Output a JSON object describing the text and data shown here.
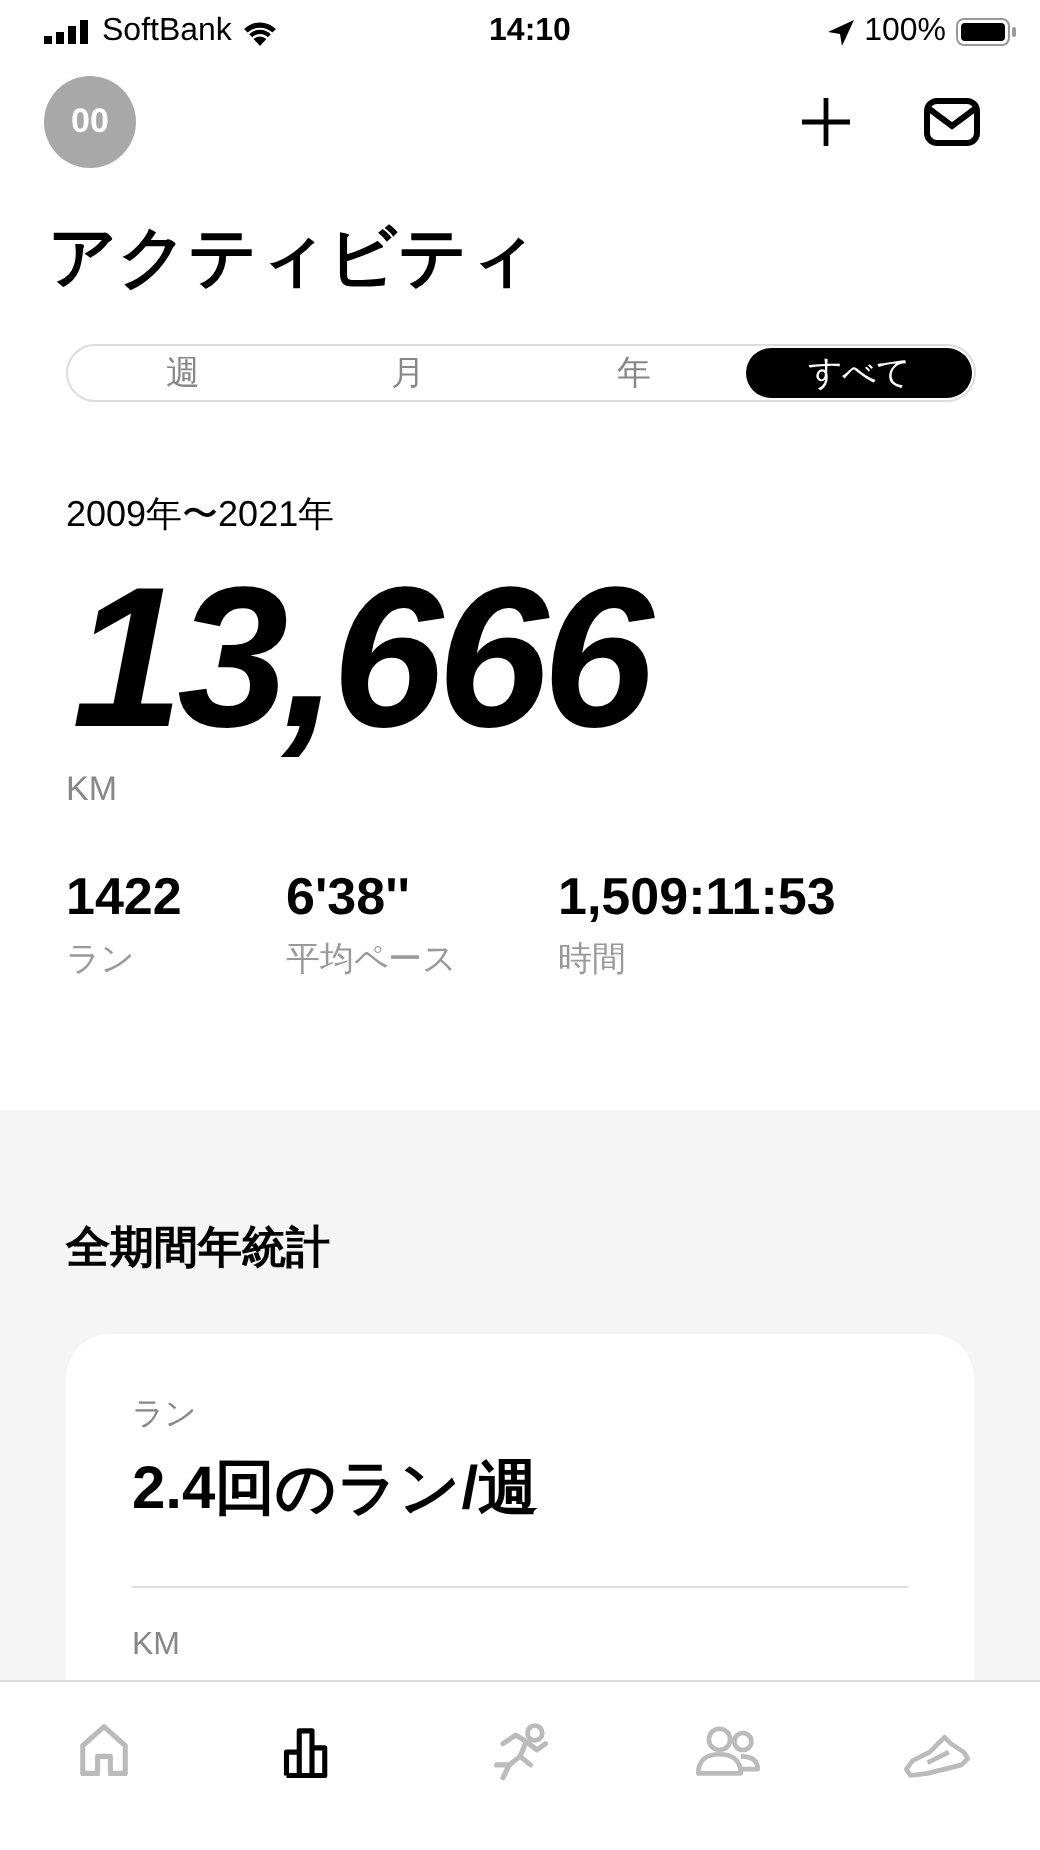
{
  "status_bar": {
    "carrier": "SoftBank",
    "time": "14:10",
    "battery": "100%"
  },
  "header": {
    "avatar": "00"
  },
  "title": "アクティビティ",
  "tabs": [
    {
      "label": "週",
      "selected": false
    },
    {
      "label": "月",
      "selected": false
    },
    {
      "label": "年",
      "selected": false
    },
    {
      "label": "すべて",
      "selected": true
    }
  ],
  "period": "2009年〜2021年",
  "total": {
    "value": "13,666",
    "unit": "KM"
  },
  "stats": [
    {
      "value": "1422",
      "label": "ラン"
    },
    {
      "value": "6'38''",
      "label": "平均ペース"
    },
    {
      "value": "1,509:11:53",
      "label": "時間"
    }
  ],
  "section": {
    "title": "全期間年統計",
    "card": [
      {
        "label": "ラン",
        "value": "2.4回のラン/週"
      },
      {
        "label": "KM"
      }
    ]
  },
  "nav": [
    {
      "kind": "home",
      "selected": false
    },
    {
      "kind": "chart",
      "selected": true
    },
    {
      "kind": "runner",
      "selected": false
    },
    {
      "kind": "people",
      "selected": false
    },
    {
      "kind": "shoe",
      "selected": false
    }
  ]
}
